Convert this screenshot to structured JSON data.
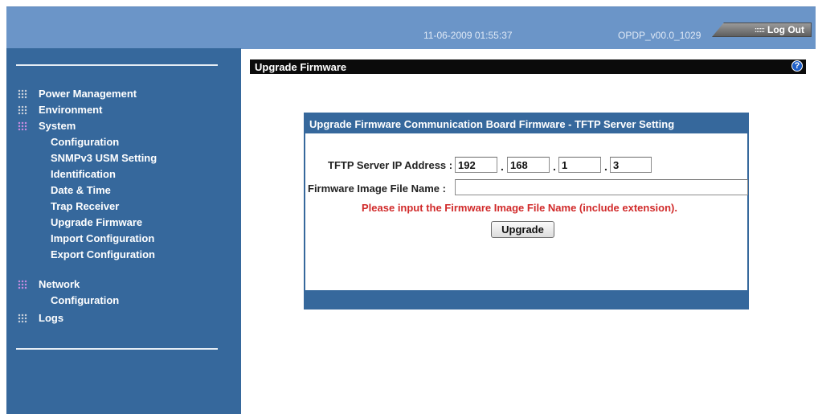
{
  "header": {
    "datetime": "11-06-2009 01:55:37",
    "version": "OPDP_v00.0_1029",
    "logout_label": "Log Out"
  },
  "sidebar": {
    "items": [
      {
        "label": "Power Management"
      },
      {
        "label": "Environment"
      },
      {
        "label": "System",
        "active": true,
        "children": [
          "Configuration",
          "SNMPv3 USM Setting",
          "Identification",
          "Date & Time",
          "Trap Receiver",
          "Upgrade Firmware",
          "Import Configuration",
          "Export Configuration"
        ]
      },
      {
        "label": "Network",
        "active": true,
        "children": [
          "Configuration"
        ]
      },
      {
        "label": "Logs"
      }
    ]
  },
  "page": {
    "title": "Upgrade Firmware"
  },
  "panel": {
    "heading": "Upgrade Firmware Communication Board Firmware - TFTP Server Setting",
    "ip_label": "TFTP Server IP Address :",
    "ip": [
      "192",
      "168",
      "1",
      "3"
    ],
    "file_label": "Firmware Image File Name :",
    "file_value": "",
    "message": "Please input the Firmware Image File Name (include extension).",
    "button_label": "Upgrade"
  },
  "colors": {
    "header": "#6b95c8",
    "sidebar": "#36689c",
    "error": "#d12a2a"
  },
  "icons": {
    "menu_bullet": "grid-dots-icon",
    "help": "help-icon"
  }
}
